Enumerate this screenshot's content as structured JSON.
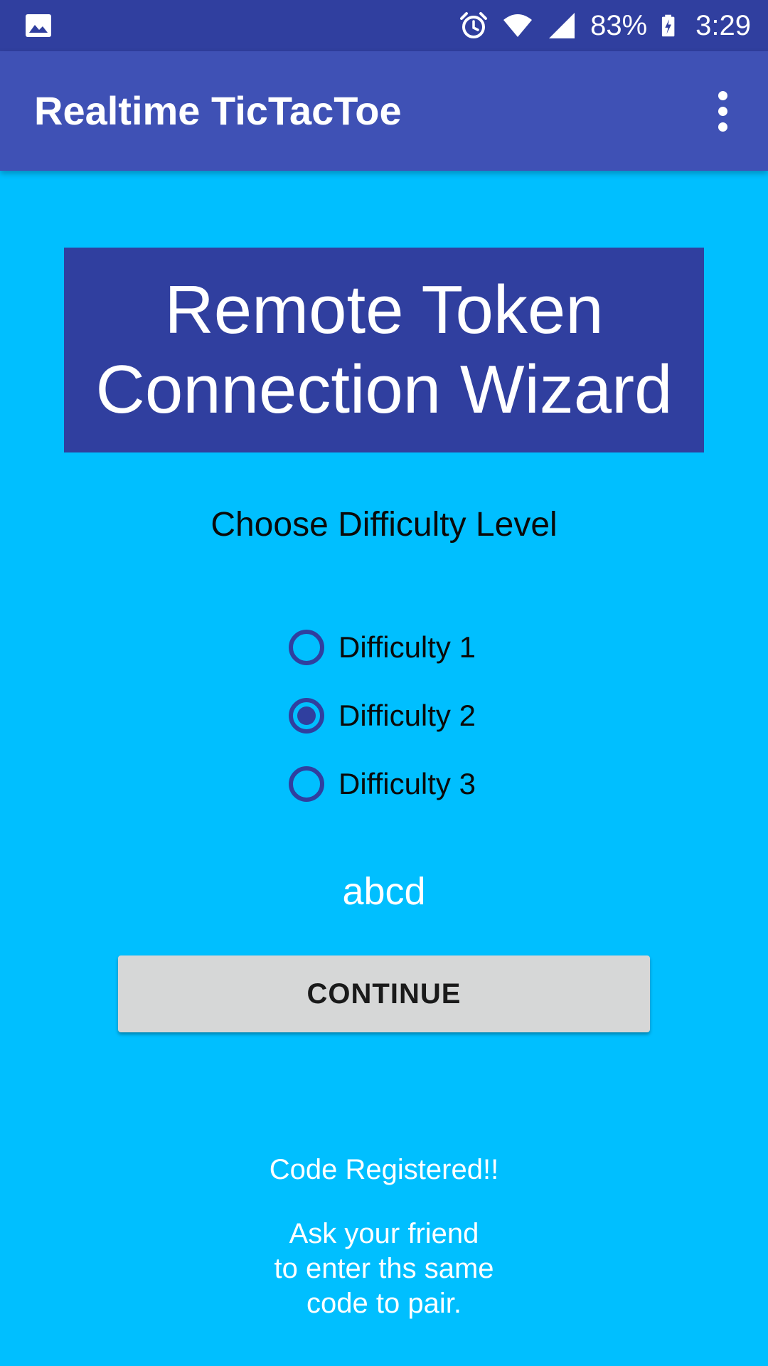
{
  "status_bar": {
    "battery": "83%",
    "time": "3:29",
    "icons": [
      "image-icon",
      "alarm-icon",
      "wifi-icon",
      "signal-icon",
      "battery-charging-icon"
    ]
  },
  "app_bar": {
    "title": "Realtime TicTacToe",
    "menu_icon": "more-vert-icon"
  },
  "banner": {
    "line1": "Remote Token",
    "line2": "Connection Wizard"
  },
  "difficulty": {
    "label": "Choose Difficulty Level",
    "options": [
      {
        "label": "Difficulty 1",
        "checked": false
      },
      {
        "label": "Difficulty 2",
        "checked": true
      },
      {
        "label": "Difficulty 3",
        "checked": false
      }
    ]
  },
  "code": "abcd",
  "continue_label": "CONTINUE",
  "messages": {
    "registered": "Code Registered!!",
    "instruction_line1": "Ask your friend",
    "instruction_line2": "to enter ths same",
    "instruction_line3": "code to pair."
  },
  "colors": {
    "background": "#00BFFF",
    "primary": "#3F51B5",
    "primary_dark": "#303F9F",
    "button": "#D6D7D7"
  }
}
